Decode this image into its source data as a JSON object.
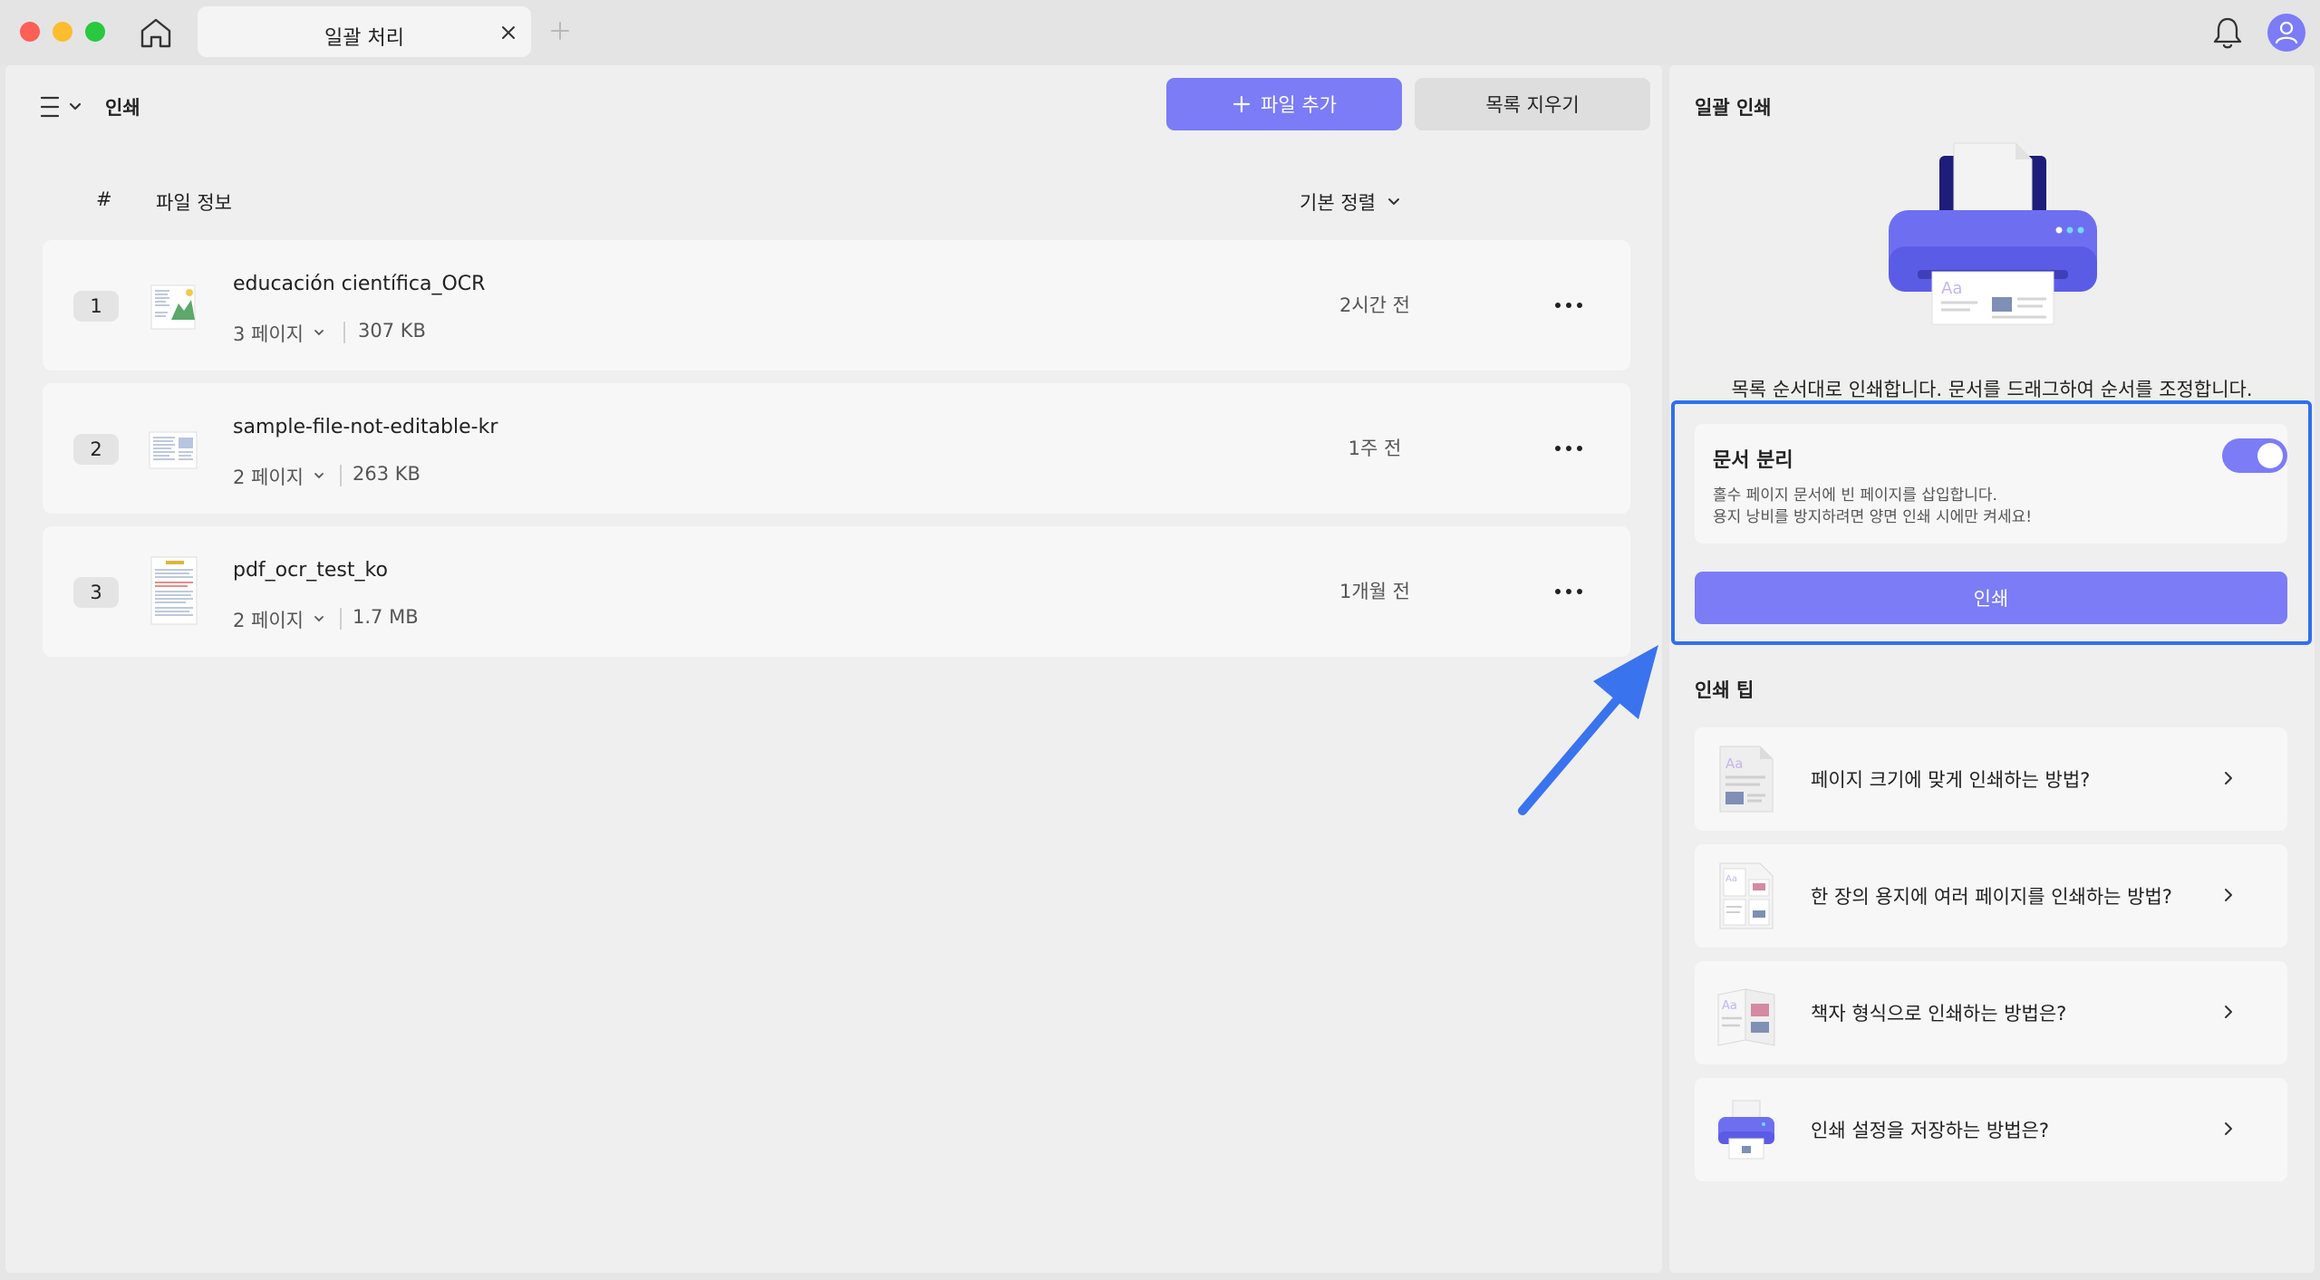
{
  "window": {
    "tab_title": "일괄 처리"
  },
  "header": {
    "title": "인쇄",
    "add_file_label": "파일 추가",
    "clear_list_label": "목록 지우기"
  },
  "table": {
    "col_number": "#",
    "col_file_info": "파일 정보",
    "sort_label": "기본 정렬",
    "rows": [
      {
        "num": "1",
        "name": "educación científica_OCR",
        "pages": "3 페이지",
        "size": "307 KB",
        "time": "2시간 전"
      },
      {
        "num": "2",
        "name": "sample-file-not-editable-kr",
        "pages": "2 페이지",
        "size": "263 KB",
        "time": "1주 전"
      },
      {
        "num": "3",
        "name": "pdf_ocr_test_ko",
        "pages": "2 페이지",
        "size": "1.7 MB",
        "time": "1개월 전"
      }
    ]
  },
  "batch_print": {
    "title": "일괄 인쇄",
    "description": "목록 순서대로 인쇄합니다. 문서를 드래그하여 순서를 조정합니다.",
    "separate": {
      "title": "문서 분리",
      "line1": "홀수 페이지 문서에 빈 페이지를 삽입합니다.",
      "line2": "용지 낭비를 방지하려면 양면 인쇄 시에만 켜세요!",
      "enabled": true
    },
    "print_label": "인쇄"
  },
  "tips": {
    "title": "인쇄 팁",
    "items": [
      {
        "label": "페이지 크기에 맞게 인쇄하는 방법?",
        "icon": "page-fit-icon"
      },
      {
        "label": "한 장의 용지에 여러 페이지를 인쇄하는 방법?",
        "icon": "multi-page-icon"
      },
      {
        "label": "책자 형식으로 인쇄하는 방법은?",
        "icon": "booklet-icon"
      },
      {
        "label": "인쇄 설정을 저장하는 방법은?",
        "icon": "printer-icon"
      }
    ]
  },
  "colors": {
    "accent": "#7b7cf6",
    "highlight": "#2f6ff0",
    "annotation_arrow": "#3a73ee"
  }
}
